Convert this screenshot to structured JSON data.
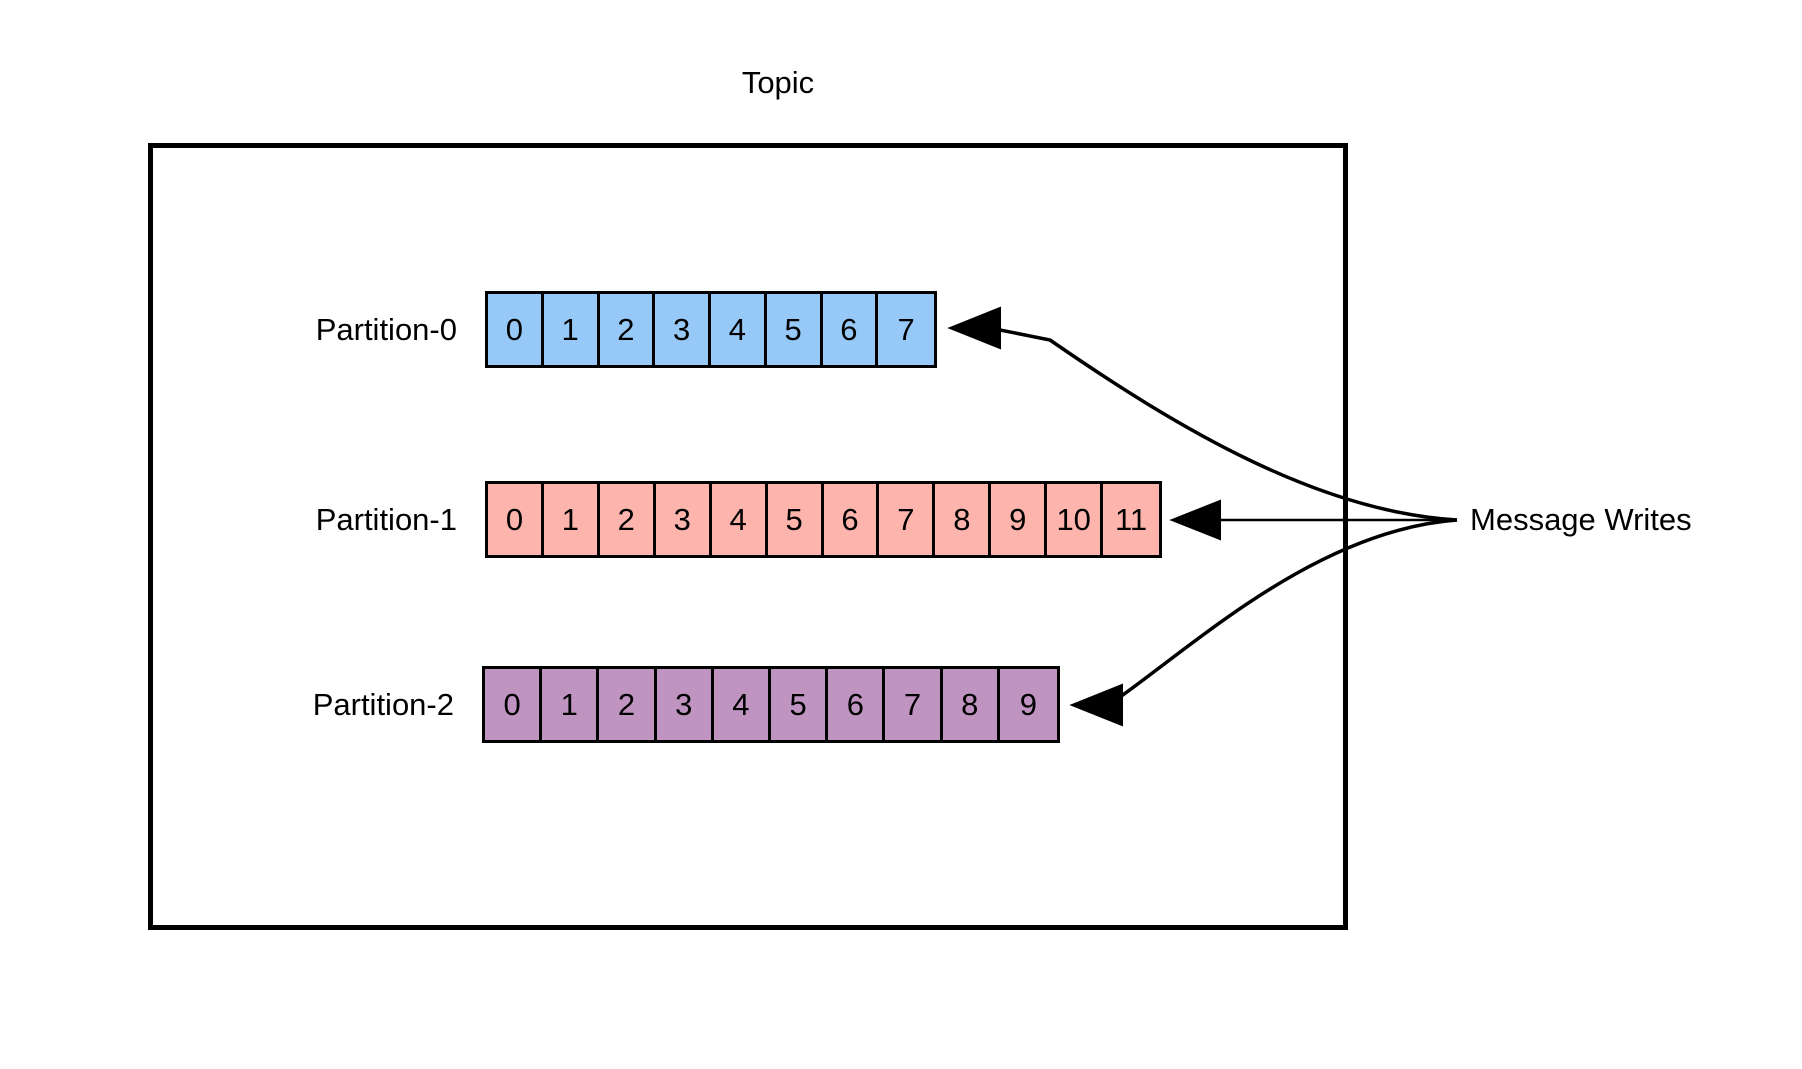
{
  "diagram": {
    "title": "Topic",
    "annotation_label": "Message Writes",
    "colors": {
      "partition0_fill": "#96c9f7",
      "partition1_fill": "#fcb4ac",
      "partition2_fill": "#bf94c1",
      "stroke": "#000000",
      "background": "#ffffff"
    },
    "partitions": [
      {
        "label": "Partition-0",
        "offsets": [
          "0",
          "1",
          "2",
          "3",
          "4",
          "5",
          "6",
          "7"
        ],
        "message_count": 8
      },
      {
        "label": "Partition-1",
        "offsets": [
          "0",
          "1",
          "2",
          "3",
          "4",
          "5",
          "6",
          "7",
          "8",
          "9",
          "10",
          "11"
        ],
        "message_count": 12
      },
      {
        "label": "Partition-2",
        "offsets": [
          "0",
          "1",
          "2",
          "3",
          "4",
          "5",
          "6",
          "7",
          "8",
          "9"
        ],
        "message_count": 10
      }
    ],
    "arrows": [
      {
        "name": "arrow-to-partition-0",
        "style": "curved",
        "target": "Partition-0"
      },
      {
        "name": "arrow-to-partition-1",
        "style": "straight",
        "target": "Partition-1"
      },
      {
        "name": "arrow-to-partition-2",
        "style": "curved",
        "target": "Partition-2"
      }
    ]
  }
}
